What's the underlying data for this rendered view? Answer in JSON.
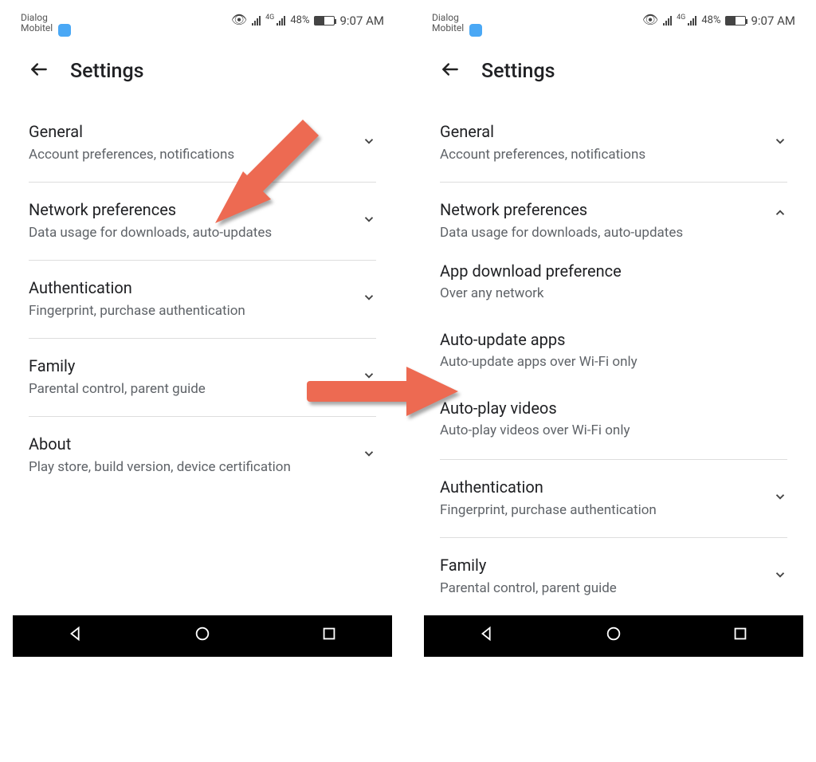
{
  "statusbar": {
    "carrier1": "Dialog",
    "carrier2": "Mobitel",
    "battery_pct": "48%",
    "time": "9:07 AM"
  },
  "header": {
    "title": "Settings"
  },
  "left": {
    "items": [
      {
        "title": "General",
        "sub": "Account preferences, notifications"
      },
      {
        "title": "Network preferences",
        "sub": "Data usage for downloads, auto-updates"
      },
      {
        "title": "Authentication",
        "sub": "Fingerprint, purchase authentication"
      },
      {
        "title": "Family",
        "sub": "Parental control, parent guide"
      },
      {
        "title": "About",
        "sub": "Play store, build version, device certification"
      }
    ]
  },
  "right": {
    "items": [
      {
        "title": "General",
        "sub": "Account preferences, notifications",
        "expanded": false
      },
      {
        "title": "Network preferences",
        "sub": "Data usage for downloads, auto-updates",
        "expanded": true,
        "children": [
          {
            "title": "App download preference",
            "sub": "Over any network"
          },
          {
            "title": "Auto-update apps",
            "sub": "Auto-update apps over Wi-Fi only"
          },
          {
            "title": "Auto-play videos",
            "sub": "Auto-play videos over Wi-Fi only"
          }
        ]
      },
      {
        "title": "Authentication",
        "sub": "Fingerprint, purchase authentication",
        "expanded": false
      },
      {
        "title": "Family",
        "sub": "Parental control, parent guide",
        "expanded": false
      }
    ]
  },
  "annotations": {
    "arrow_color": "#ed6a52"
  }
}
